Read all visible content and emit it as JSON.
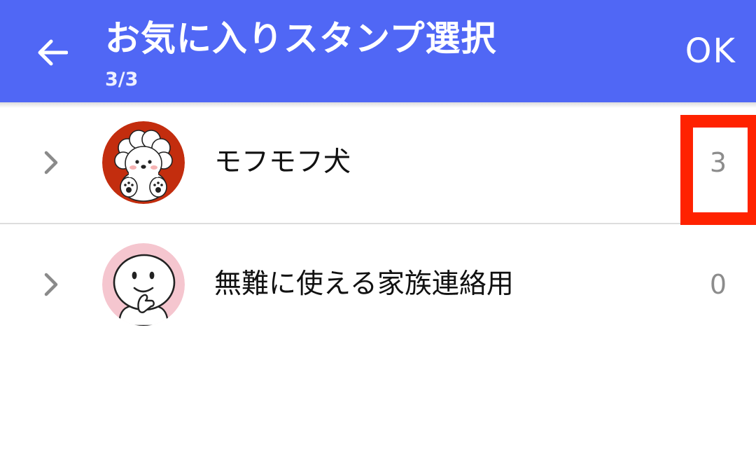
{
  "header": {
    "title": "お気に入りスタンプ選択",
    "subtitle": "3/3",
    "ok_label": "OK",
    "back_icon": "arrow-left-icon",
    "background_color": "#5067f5"
  },
  "list": {
    "items": [
      {
        "label": "モフモフ犬",
        "count": "3",
        "icon": "fluffy-dog-sticker",
        "avatar_color": "#c32d0e",
        "highlighted": true
      },
      {
        "label": "無難に使える家族連絡用",
        "count": "0",
        "icon": "smiley-thinking-sticker",
        "avatar_color": "#f5c6cf",
        "highlighted": false
      }
    ]
  },
  "annotation": {
    "highlight_color": "#ff2200"
  }
}
